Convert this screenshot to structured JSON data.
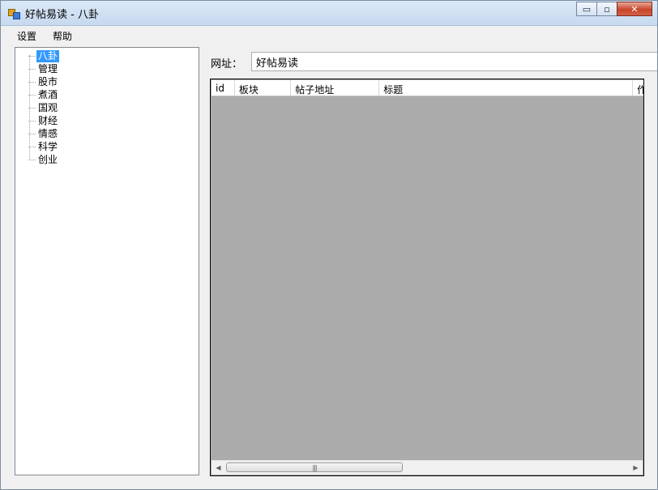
{
  "window": {
    "title": "好帖易读 - 八卦",
    "controls": {
      "minimize": "▭",
      "maximize": "▫",
      "close": "✕"
    }
  },
  "menu": {
    "items": [
      {
        "label": "设置"
      },
      {
        "label": "帮助"
      }
    ]
  },
  "tree": {
    "items": [
      {
        "label": "八卦",
        "selected": true
      },
      {
        "label": "管理"
      },
      {
        "label": "股市"
      },
      {
        "label": "煮酒"
      },
      {
        "label": "国观"
      },
      {
        "label": "财经"
      },
      {
        "label": "情感"
      },
      {
        "label": "科学"
      },
      {
        "label": "创业"
      }
    ]
  },
  "url": {
    "label": "网址：",
    "value": "好帖易读"
  },
  "grid": {
    "columns": [
      {
        "label": "id"
      },
      {
        "label": "板块"
      },
      {
        "label": "帖子地址"
      },
      {
        "label": "标题"
      },
      {
        "label": "作"
      }
    ]
  },
  "scrollbar": {
    "left_arrow": "◀",
    "right_arrow": "▶",
    "grip": "|||"
  },
  "colors": {
    "selection": "#3399ff",
    "grid_background": "#ababab"
  },
  "icons": {
    "app": "app-icon"
  }
}
